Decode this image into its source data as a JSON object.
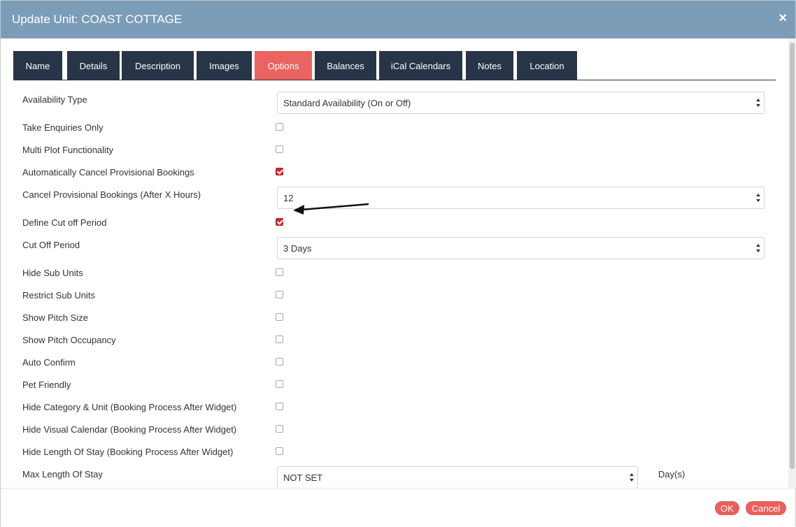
{
  "dialog": {
    "title": "Update Unit: COAST COTTAGE",
    "close_glyph": "×"
  },
  "tabs": [
    {
      "label": "Name",
      "active": false
    },
    {
      "label": "Details",
      "active": false
    },
    {
      "label": "Description",
      "active": false
    },
    {
      "label": "Images",
      "active": false
    },
    {
      "label": "Options",
      "active": true
    },
    {
      "label": "Balances",
      "active": false
    },
    {
      "label": "iCal Calendars",
      "active": false
    },
    {
      "label": "Notes",
      "active": false
    },
    {
      "label": "Location",
      "active": false
    }
  ],
  "options": {
    "availability_type": {
      "label": "Availability Type",
      "value": "Standard Availability (On or Off)"
    },
    "take_enquiries_only": {
      "label": "Take Enquiries Only",
      "checked": false
    },
    "multi_plot": {
      "label": "Multi Plot Functionality",
      "checked": false
    },
    "auto_cancel_provisional": {
      "label": "Automatically Cancel Provisional Bookings",
      "checked": true
    },
    "cancel_after_hours": {
      "label": "Cancel Provisional Bookings (After X Hours)",
      "value": "12"
    },
    "define_cutoff": {
      "label": "Define Cut off Period",
      "checked": true
    },
    "cutoff_period": {
      "label": "Cut Off Period",
      "value": "3 Days"
    },
    "hide_sub_units": {
      "label": "Hide Sub Units",
      "checked": false
    },
    "restrict_sub_units": {
      "label": "Restrict Sub Units",
      "checked": false
    },
    "show_pitch_size": {
      "label": "Show Pitch Size",
      "checked": false
    },
    "show_pitch_occupancy": {
      "label": "Show Pitch Occupancy",
      "checked": false
    },
    "auto_confirm": {
      "label": "Auto Confirm",
      "checked": false
    },
    "pet_friendly": {
      "label": "Pet Friendly",
      "checked": false
    },
    "hide_category_unit": {
      "label": "Hide Category & Unit (Booking Process After Widget)",
      "checked": false
    },
    "hide_visual_calendar": {
      "label": "Hide Visual Calendar (Booking Process After Widget)",
      "checked": false
    },
    "hide_length_of_stay": {
      "label": "Hide Length Of Stay (Booking Process After Widget)",
      "checked": false
    },
    "max_length_of_stay": {
      "label": "Max Length Of Stay",
      "value": "NOT SET",
      "unit": "Day(s)"
    }
  },
  "footer": {
    "ok_label": "OK",
    "cancel_label": "Cancel"
  },
  "colors": {
    "titlebar": "#7b9db8",
    "tab_bg": "#283447",
    "tab_active": "#ea6461",
    "checkbox_checked": "#d7292c",
    "button": "#e95f5c"
  }
}
